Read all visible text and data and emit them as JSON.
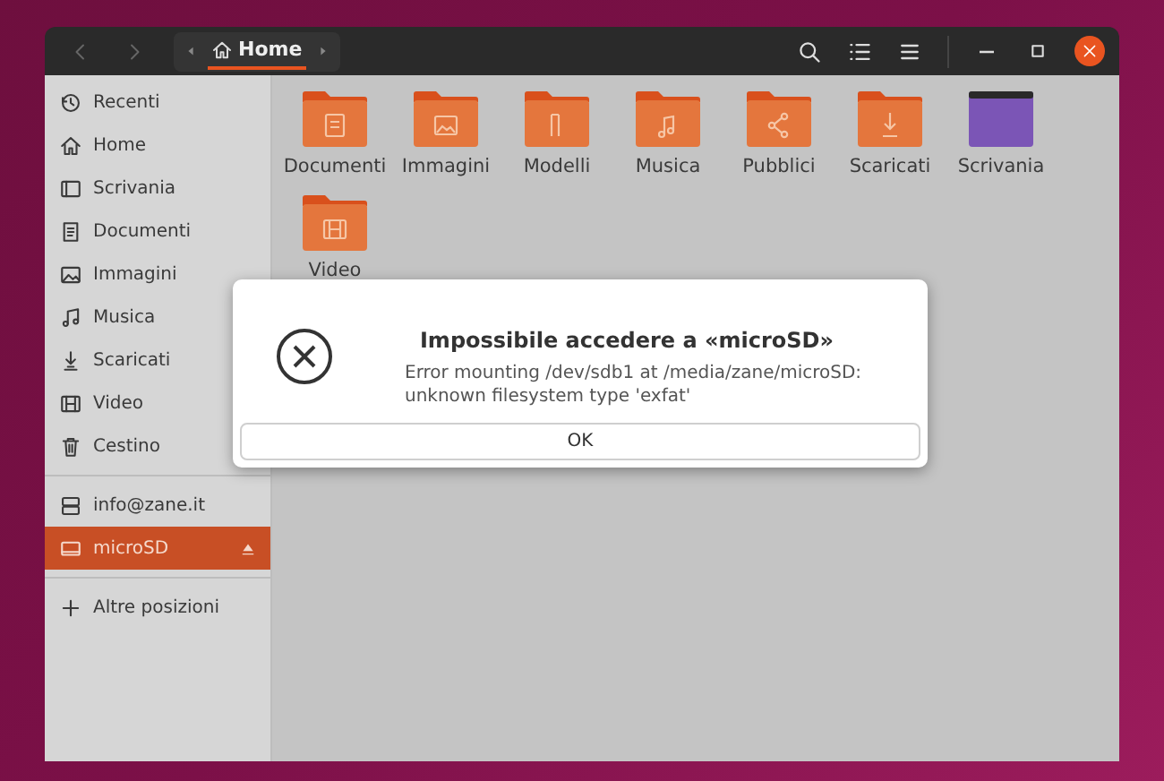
{
  "header": {
    "nav_buttons": [
      {
        "disabled": true
      },
      {
        "disabled": true
      }
    ],
    "path": {
      "label": "Home",
      "selected": true
    }
  },
  "sidebar": {
    "sections": [
      [
        {
          "label": "Recenti",
          "kind": "recent",
          "selected": false
        },
        {
          "label": "Home",
          "kind": "home",
          "selected": false
        },
        {
          "label": "Scrivania",
          "kind": "desktop",
          "selected": false
        },
        {
          "label": "Documenti",
          "kind": "documents",
          "selected": false
        },
        {
          "label": "Immagini",
          "kind": "pictures",
          "selected": false
        },
        {
          "label": "Musica",
          "kind": "music",
          "selected": false
        },
        {
          "label": "Scaricati",
          "kind": "downloads",
          "selected": false
        },
        {
          "label": "Video",
          "kind": "video",
          "selected": false
        },
        {
          "label": "Cestino",
          "kind": "trash",
          "selected": false
        }
      ],
      [
        {
          "label": "info@zane.it",
          "kind": "server",
          "selected": false
        },
        {
          "label": "microSD",
          "kind": "drive",
          "selected": true,
          "ejectable": true
        }
      ],
      [
        {
          "label": "Altre posizioni",
          "kind": "add",
          "selected": false
        }
      ]
    ]
  },
  "folders": [
    {
      "name": "Documenti",
      "kind": "documents"
    },
    {
      "name": "Immagini",
      "kind": "pictures"
    },
    {
      "name": "Modelli",
      "kind": "templates"
    },
    {
      "name": "Musica",
      "kind": "music"
    },
    {
      "name": "Pubblici",
      "kind": "public"
    },
    {
      "name": "Scaricati",
      "kind": "downloads"
    },
    {
      "name": "Scrivania",
      "kind": "desktop"
    },
    {
      "name": "Video",
      "kind": "video"
    }
  ],
  "dialog": {
    "title": "Impossibile accedere a «microSD»",
    "message": "Error mounting /dev/sdb1 at /media/zane/microSD:\nunknown filesystem type 'exfat'",
    "button": "OK"
  }
}
